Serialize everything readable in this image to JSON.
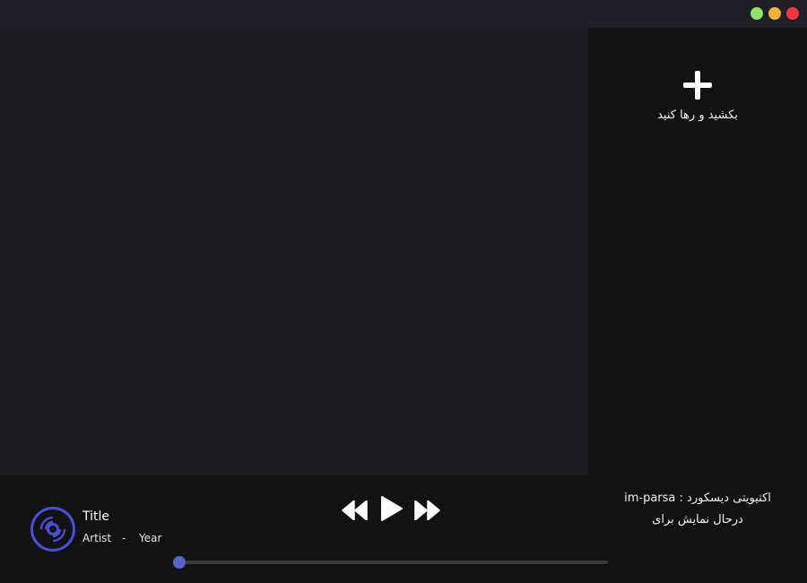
{
  "window": {
    "controls": [
      "maximize",
      "minimize",
      "close"
    ],
    "colors": {
      "maximize": "#8fe36a",
      "minimize": "#f3b43f",
      "close": "#f03a3f"
    }
  },
  "drop_zone": {
    "icon": "plus-icon",
    "label": "بکشید و رها کنید"
  },
  "track": {
    "icon": "vinyl-disc-icon",
    "title": "Title",
    "artist": "Artist",
    "separator": "-",
    "year": "Year"
  },
  "controls": {
    "previous_icon": "rewind-icon",
    "play_icon": "play-icon",
    "next_icon": "fast-forward-icon"
  },
  "progress": {
    "fraction": 0.0,
    "color": "#5b63c9"
  },
  "discord": {
    "line1": "اکتیویتی دیسکورد : im-parsa",
    "line2": "درحال نمایش برای"
  }
}
